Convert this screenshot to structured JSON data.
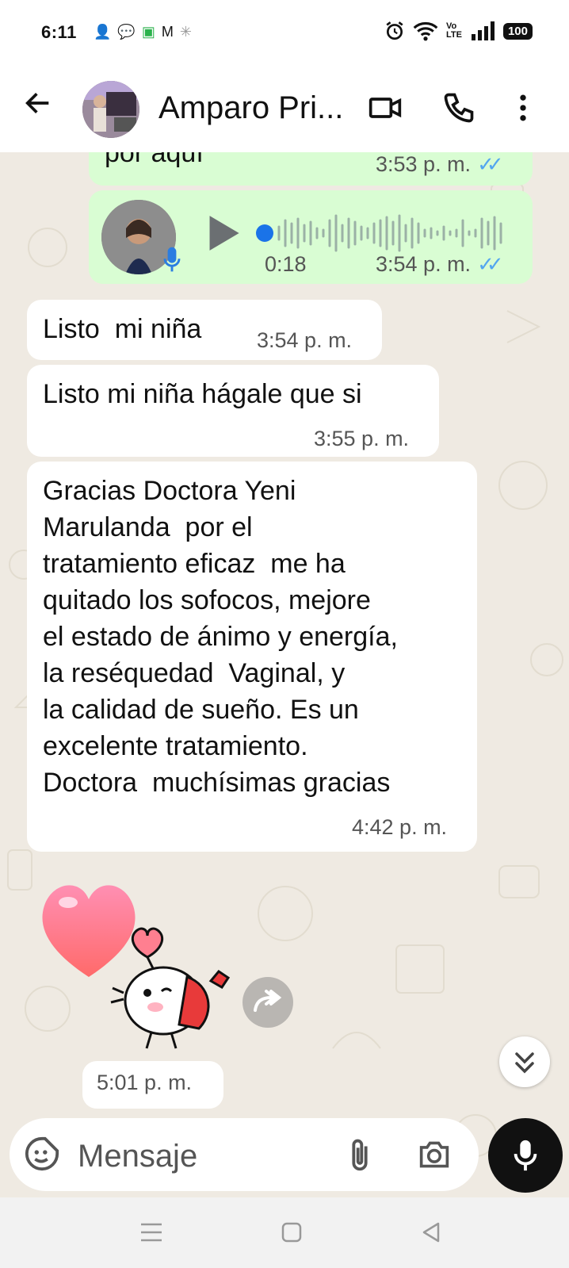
{
  "status_bar": {
    "time": "6:11",
    "battery": "100",
    "network": "Vo LTE"
  },
  "header": {
    "contact_name": "Amparo Pri...",
    "icons": [
      "back-arrow-icon",
      "video-call-icon",
      "phone-icon",
      "more-vert-icon"
    ]
  },
  "messages": [
    {
      "direction": "out",
      "text": "por aquí",
      "time": "3:53 p. m.",
      "read": true
    },
    {
      "direction": "out",
      "type": "voice",
      "duration": "0:18",
      "time": "3:54 p. m.",
      "read": true
    },
    {
      "direction": "in",
      "text": "Listo  mi niña",
      "time": "3:54 p. m."
    },
    {
      "direction": "in",
      "text": "Listo mi niña hágale que si",
      "time": "3:55 p. m."
    },
    {
      "direction": "in",
      "lines": [
        "Gracias Doctora Yeni",
        "Marulanda  por el",
        "tratamiento eficaz  me ha",
        "quitado los sofocos, mejore",
        "el estado de ánimo y energía,",
        "la reséquedad  Vaginal, y",
        "la calidad de sueño. Es un",
        "excelente tratamiento.",
        "Doctora  muchísimas gracias"
      ],
      "time": "4:42 p. m."
    },
    {
      "direction": "in",
      "type": "sticker",
      "time": "5:01 p. m."
    }
  ],
  "composer": {
    "placeholder": "Mensaje"
  },
  "colors": {
    "chat_bg": "#efeae2",
    "outgoing": "#d9fdd3",
    "incoming": "#ffffff",
    "read_ticks": "#53a6ef",
    "voice_dot": "#1a73e8"
  }
}
